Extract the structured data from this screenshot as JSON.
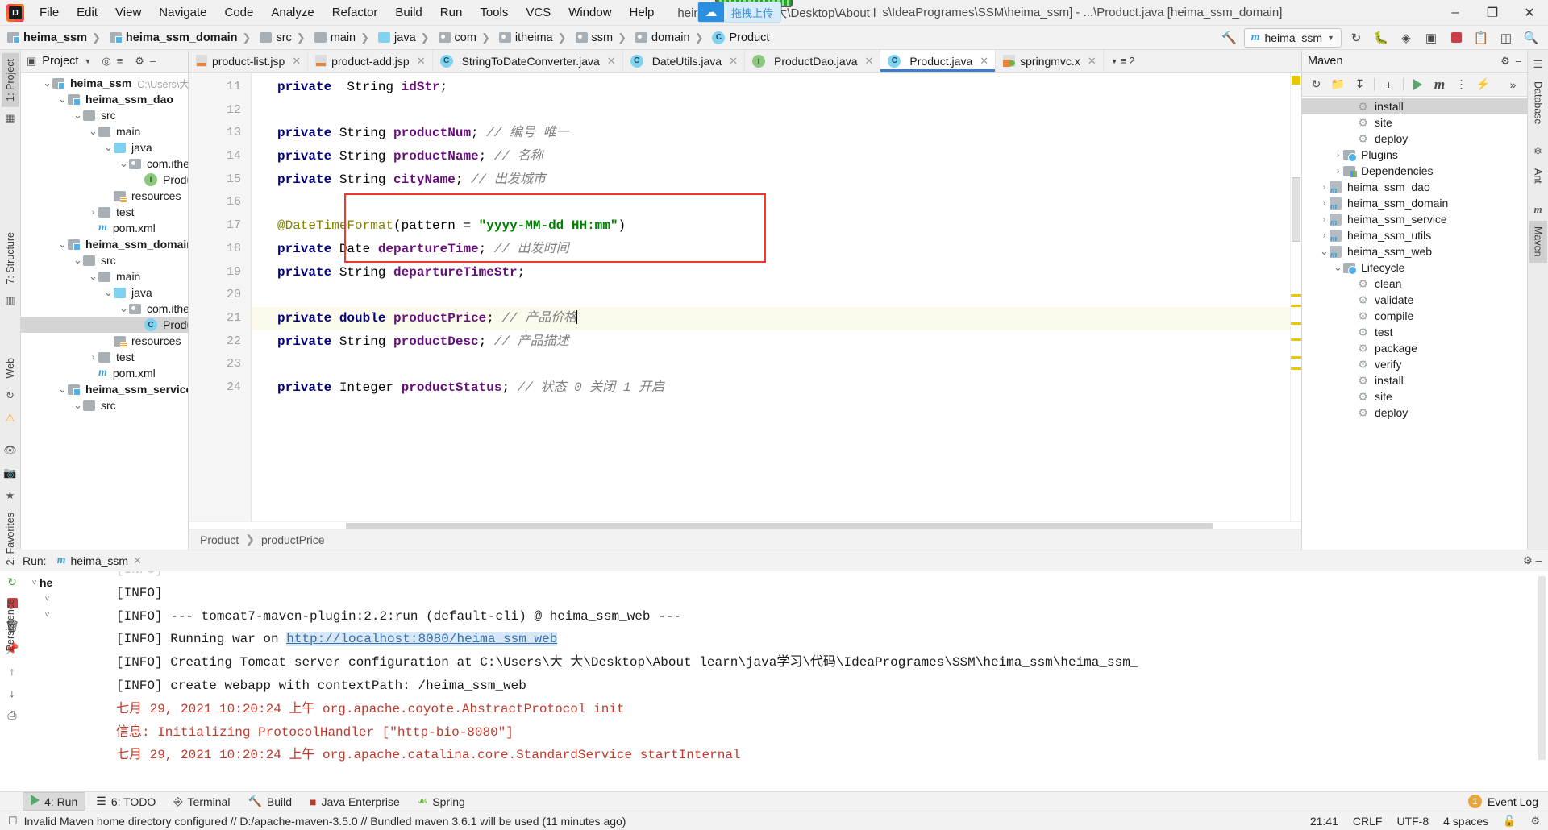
{
  "titlebar": {
    "logo": "intellij-logo",
    "menus": [
      "File",
      "Edit",
      "View",
      "Navigate",
      "Code",
      "Analyze",
      "Refactor",
      "Build",
      "Run",
      "Tools",
      "VCS",
      "Window",
      "Help"
    ],
    "window_title_left": "heima_ssm [...\\大 大\\Desktop\\About l",
    "window_title_right": "s\\IdeaProgrames\\SSM\\heima_ssm] - ...\\Product.java [heima_ssm_domain]",
    "upload_badge": "拖拽上传",
    "minimize": "–",
    "maximize": "❐",
    "close": "✕"
  },
  "navbar": {
    "crumbs": [
      {
        "label": "heima_ssm",
        "icon": "module-icon",
        "bold": true
      },
      {
        "label": "heima_ssm_domain",
        "icon": "module-icon",
        "bold": true
      },
      {
        "label": "src",
        "icon": "folder-icon",
        "bold": false
      },
      {
        "label": "main",
        "icon": "folder-icon",
        "bold": false
      },
      {
        "label": "java",
        "icon": "source-folder-icon",
        "bold": false
      },
      {
        "label": "com",
        "icon": "package-icon",
        "bold": false
      },
      {
        "label": "itheima",
        "icon": "package-icon",
        "bold": false
      },
      {
        "label": "ssm",
        "icon": "package-icon",
        "bold": false
      },
      {
        "label": "domain",
        "icon": "package-icon",
        "bold": false
      },
      {
        "label": "Product",
        "icon": "class-icon",
        "bold": false
      }
    ],
    "run_config": "heima_ssm",
    "icons": [
      "build-hammer-icon",
      "rerun-icon",
      "debug-icon",
      "coverage-icon",
      "profile-icon",
      "stop-icon",
      "update-app-icon",
      "layout-icon",
      "search-icon"
    ]
  },
  "project_panel": {
    "title": "Project",
    "header_icons": [
      "project-view-icon",
      "dropdown-caret-icon",
      "locate-icon",
      "collapse-all-icon",
      "settings-gear-icon",
      "hide-icon"
    ],
    "tree": [
      {
        "indent": 0,
        "twist": "v",
        "icon": "module",
        "label": "heima_ssm",
        "bold": true,
        "path": "C:\\Users\\大 大\\De"
      },
      {
        "indent": 1,
        "twist": "v",
        "icon": "module",
        "label": "heima_ssm_dao",
        "bold": true
      },
      {
        "indent": 2,
        "twist": "v",
        "icon": "folder",
        "label": "src"
      },
      {
        "indent": 3,
        "twist": "v",
        "icon": "folder",
        "label": "main"
      },
      {
        "indent": 4,
        "twist": "v",
        "icon": "source-folder",
        "label": "java"
      },
      {
        "indent": 5,
        "twist": "v",
        "icon": "package",
        "label": "com.itheima"
      },
      {
        "indent": 6,
        "twist": "",
        "icon": "interface",
        "label": "ProductD"
      },
      {
        "indent": 4,
        "twist": "",
        "icon": "resources",
        "label": "resources"
      },
      {
        "indent": 3,
        "twist": ">",
        "icon": "folder",
        "label": "test"
      },
      {
        "indent": 3,
        "twist": "",
        "icon": "maven-m",
        "label": "pom.xml"
      },
      {
        "indent": 1,
        "twist": "v",
        "icon": "module",
        "label": "heima_ssm_domain",
        "bold": true
      },
      {
        "indent": 2,
        "twist": "v",
        "icon": "folder",
        "label": "src"
      },
      {
        "indent": 3,
        "twist": "v",
        "icon": "folder",
        "label": "main"
      },
      {
        "indent": 4,
        "twist": "v",
        "icon": "source-folder",
        "label": "java"
      },
      {
        "indent": 5,
        "twist": "v",
        "icon": "package",
        "label": "com.itheima"
      },
      {
        "indent": 6,
        "twist": "",
        "icon": "class",
        "label": "Product",
        "selected": true
      },
      {
        "indent": 4,
        "twist": "",
        "icon": "resources",
        "label": "resources"
      },
      {
        "indent": 3,
        "twist": ">",
        "icon": "folder",
        "label": "test"
      },
      {
        "indent": 3,
        "twist": "",
        "icon": "maven-m",
        "label": "pom.xml"
      },
      {
        "indent": 1,
        "twist": "v",
        "icon": "module",
        "label": "heima_ssm_service",
        "bold": true
      },
      {
        "indent": 2,
        "twist": "v",
        "icon": "folder",
        "label": "src"
      }
    ]
  },
  "left_rail": {
    "tabs": [
      "1: Project",
      "7: Structure",
      "Web",
      "2: Favorites",
      "Persistence"
    ]
  },
  "right_rail": {
    "tabs": [
      "Database",
      "Ant",
      "Maven"
    ]
  },
  "editor": {
    "tabs": [
      {
        "label": "product-list.jsp",
        "icon": "jsp-file-icon",
        "active": false
      },
      {
        "label": "product-add.jsp",
        "icon": "jsp-file-icon",
        "active": false
      },
      {
        "label": "StringToDateConverter.java",
        "icon": "class-icon",
        "active": false
      },
      {
        "label": "DateUtils.java",
        "icon": "class-icon",
        "active": false
      },
      {
        "label": "ProductDao.java",
        "icon": "interface-icon",
        "active": false
      },
      {
        "label": "Product.java",
        "icon": "class-icon",
        "active": true
      },
      {
        "label": "springmvc.x",
        "icon": "xml-file-icon",
        "active": false
      }
    ],
    "tabs_overflow": "2",
    "lines": [
      {
        "num": "11",
        "segments": [
          {
            "t": "private",
            "c": "kw"
          },
          {
            "t": "  String ",
            "c": "id"
          },
          {
            "t": "idStr",
            "c": "fld"
          },
          {
            "t": ";",
            "c": "id"
          }
        ]
      },
      {
        "num": "12",
        "segments": []
      },
      {
        "num": "13",
        "segments": [
          {
            "t": "private",
            "c": "kw"
          },
          {
            "t": " String ",
            "c": "id"
          },
          {
            "t": "productNum",
            "c": "fld"
          },
          {
            "t": "; ",
            "c": "id"
          },
          {
            "t": "// 编号 唯一",
            "c": "cmt"
          }
        ]
      },
      {
        "num": "14",
        "segments": [
          {
            "t": "private",
            "c": "kw"
          },
          {
            "t": " String ",
            "c": "id"
          },
          {
            "t": "productName",
            "c": "fld"
          },
          {
            "t": "; ",
            "c": "id"
          },
          {
            "t": "// 名称",
            "c": "cmt"
          }
        ]
      },
      {
        "num": "15",
        "segments": [
          {
            "t": "private",
            "c": "kw"
          },
          {
            "t": " String ",
            "c": "id"
          },
          {
            "t": "cityName",
            "c": "fld"
          },
          {
            "t": "; ",
            "c": "id"
          },
          {
            "t": "// 出发城市",
            "c": "cmt"
          }
        ]
      },
      {
        "num": "16",
        "segments": []
      },
      {
        "num": "17",
        "segments": [
          {
            "t": "@DateTimeFormat",
            "c": "ann"
          },
          {
            "t": "(pattern = ",
            "c": "id"
          },
          {
            "t": "\"yyyy-MM-dd HH:mm\"",
            "c": "str"
          },
          {
            "t": ")",
            "c": "id"
          }
        ]
      },
      {
        "num": "18",
        "segments": [
          {
            "t": "private",
            "c": "kw"
          },
          {
            "t": " Date ",
            "c": "id"
          },
          {
            "t": "departureTime",
            "c": "fld"
          },
          {
            "t": "; ",
            "c": "id"
          },
          {
            "t": "// 出发时间",
            "c": "cmt"
          }
        ]
      },
      {
        "num": "19",
        "segments": [
          {
            "t": "private",
            "c": "kw"
          },
          {
            "t": " String ",
            "c": "id"
          },
          {
            "t": "departureTimeStr",
            "c": "fld"
          },
          {
            "t": ";",
            "c": "id"
          }
        ]
      },
      {
        "num": "20",
        "segments": []
      },
      {
        "num": "21",
        "highlight": true,
        "caret": true,
        "segments": [
          {
            "t": "private",
            "c": "kw"
          },
          {
            "t": " ",
            "c": "id"
          },
          {
            "t": "double",
            "c": "kw"
          },
          {
            "t": " ",
            "c": "id"
          },
          {
            "t": "productPrice",
            "c": "fld"
          },
          {
            "t": "; ",
            "c": "id"
          },
          {
            "t": "// 产品价格",
            "c": "cmt"
          }
        ]
      },
      {
        "num": "22",
        "segments": [
          {
            "t": "private",
            "c": "kw"
          },
          {
            "t": " String ",
            "c": "id"
          },
          {
            "t": "productDesc",
            "c": "fld"
          },
          {
            "t": "; ",
            "c": "id"
          },
          {
            "t": "// 产品描述",
            "c": "cmt"
          }
        ]
      },
      {
        "num": "23",
        "segments": []
      },
      {
        "num": "24",
        "segments": [
          {
            "t": "private",
            "c": "kw"
          },
          {
            "t": " Integer ",
            "c": "id"
          },
          {
            "t": "productStatus",
            "c": "fld"
          },
          {
            "t": "; ",
            "c": "id"
          },
          {
            "t": "// 状态 0 关闭 1 开启",
            "c": "cmt"
          }
        ]
      }
    ],
    "annotation_box_color": "#f3372f",
    "breadcrumb": [
      "Product",
      "productPrice"
    ]
  },
  "maven": {
    "title": "Maven",
    "toolbar_icons": [
      "reimport-icon",
      "offline-icon",
      "download-sources-icon",
      "add-icon",
      "run-icon",
      "execute-goal-icon",
      "toggle-skip-tests-icon",
      "toggle-offline-icon",
      "expand-more-icon"
    ],
    "header_icons": [
      "settings-gear-icon",
      "hide-icon"
    ],
    "tree": [
      {
        "indent": 3,
        "twist": "",
        "icon": "goal",
        "label": "install",
        "selected": true
      },
      {
        "indent": 3,
        "twist": "",
        "icon": "goal",
        "label": "site"
      },
      {
        "indent": 3,
        "twist": "",
        "icon": "goal",
        "label": "deploy"
      },
      {
        "indent": 2,
        "twist": ">",
        "icon": "plugins",
        "label": "Plugins"
      },
      {
        "indent": 2,
        "twist": ">",
        "icon": "deps",
        "label": "Dependencies"
      },
      {
        "indent": 1,
        "twist": ">",
        "icon": "mvnmodule",
        "label": "heima_ssm_dao"
      },
      {
        "indent": 1,
        "twist": ">",
        "icon": "mvnmodule",
        "label": "heima_ssm_domain"
      },
      {
        "indent": 1,
        "twist": ">",
        "icon": "mvnmodule",
        "label": "heima_ssm_service"
      },
      {
        "indent": 1,
        "twist": ">",
        "icon": "mvnmodule",
        "label": "heima_ssm_utils"
      },
      {
        "indent": 1,
        "twist": "v",
        "icon": "mvnmodule",
        "label": "heima_ssm_web"
      },
      {
        "indent": 2,
        "twist": "v",
        "icon": "plugins",
        "label": "Lifecycle"
      },
      {
        "indent": 3,
        "twist": "",
        "icon": "goal",
        "label": "clean"
      },
      {
        "indent": 3,
        "twist": "",
        "icon": "goal",
        "label": "validate"
      },
      {
        "indent": 3,
        "twist": "",
        "icon": "goal",
        "label": "compile"
      },
      {
        "indent": 3,
        "twist": "",
        "icon": "goal",
        "label": "test"
      },
      {
        "indent": 3,
        "twist": "",
        "icon": "goal",
        "label": "package"
      },
      {
        "indent": 3,
        "twist": "",
        "icon": "goal",
        "label": "verify"
      },
      {
        "indent": 3,
        "twist": "",
        "icon": "goal",
        "label": "install"
      },
      {
        "indent": 3,
        "twist": "",
        "icon": "goal",
        "label": "site"
      },
      {
        "indent": 3,
        "twist": "",
        "icon": "goal",
        "label": "deploy"
      }
    ]
  },
  "run_panel": {
    "label": "Run:",
    "tab": "heima_ssm",
    "tree_items": [
      "he"
    ],
    "console": [
      {
        "segments": [
          {
            "t": "[INFO]",
            "c": ""
          }
        ]
      },
      {
        "segments": [
          {
            "t": "[INFO] --- tomcat7-maven-plugin:2.2:run (default-cli) @ heima_ssm_web ---",
            "c": ""
          }
        ]
      },
      {
        "segments": [
          {
            "t": "[INFO] Running war on ",
            "c": ""
          },
          {
            "t": "http://localhost:8080/heima_ssm_web",
            "c": "link"
          }
        ]
      },
      {
        "segments": [
          {
            "t": "[INFO] Creating Tomcat server configuration at C:\\Users\\大 大\\Desktop\\About learn\\java学习\\代码\\IdeaProgrames\\SSM\\heima_ssm\\heima_ssm_",
            "c": ""
          }
        ]
      },
      {
        "segments": [
          {
            "t": "[INFO] create webapp with contextPath: /heima_ssm_web",
            "c": ""
          }
        ]
      },
      {
        "segments": [
          {
            "t": "七月 29, 2021 10:20:24 上午 org.apache.coyote.AbstractProtocol init",
            "c": "red"
          }
        ]
      },
      {
        "segments": [
          {
            "t": "信息: Initializing ProtocolHandler [\"http-bio-8080\"]",
            "c": "red"
          }
        ]
      },
      {
        "segments": [
          {
            "t": "七月 29, 2021 10:20:24 上午 org.apache.catalina.core.StandardService startInternal",
            "c": "red"
          }
        ]
      }
    ],
    "hidden_first_line": "[INFO]"
  },
  "toolwindow_bar": {
    "buttons": [
      {
        "label": "4: Run",
        "icon": "run-icon",
        "active": true
      },
      {
        "label": "6: TODO",
        "icon": "todo-icon",
        "active": false
      },
      {
        "label": "Terminal",
        "icon": "terminal-icon",
        "active": false
      },
      {
        "label": "Build",
        "icon": "build-icon",
        "active": false
      },
      {
        "label": "Java Enterprise",
        "icon": "java-enterprise-icon",
        "active": false
      },
      {
        "label": "Spring",
        "icon": "spring-icon",
        "active": false
      }
    ],
    "event_count": "1",
    "event_log": "Event Log"
  },
  "statusbar": {
    "message": "Invalid Maven home directory configured // D:/apache-maven-3.5.0 // Bundled maven 3.6.1 will be used (11 minutes ago)",
    "time": "21:41",
    "line_separator": "CRLF",
    "encoding": "UTF-8",
    "indent": "4 spaces",
    "icons": [
      "lock-icon",
      "inspection-icon"
    ]
  },
  "colors": {
    "accent_blue": "#3d7eca",
    "annotation_red": "#f3372f",
    "keyword": "#000080",
    "field": "#660e7a",
    "comment": "#808080",
    "string": "#008000",
    "annotation": "#808000",
    "selection_gray": "#d4d4d4",
    "highlight_line": "#fcfaed"
  }
}
